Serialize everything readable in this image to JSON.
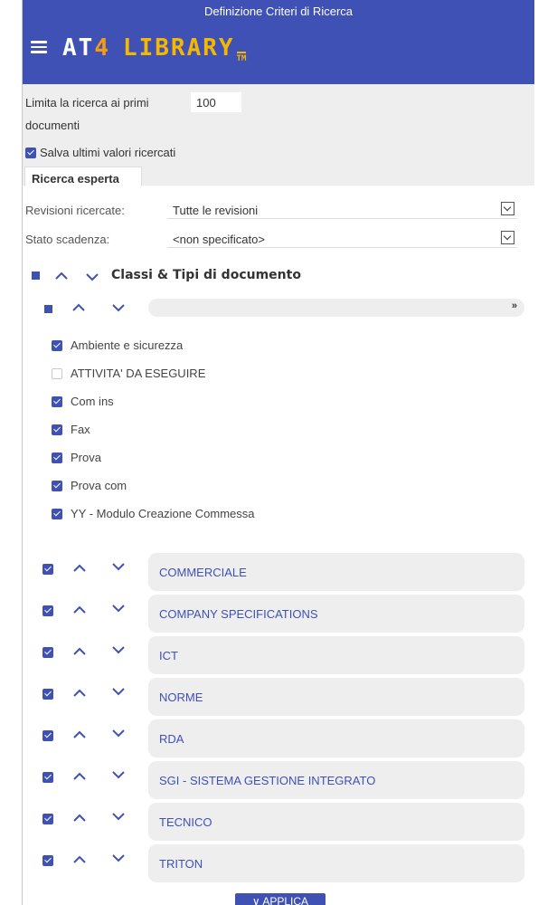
{
  "window": {
    "title": "Definizione Criteri di Ricerca"
  },
  "app": {
    "logo_at": "AT",
    "logo_four": "4",
    "logo_library": "LIBRARY",
    "logo_tm": "TM"
  },
  "options": {
    "limit_prefix": "Limita la ricerca ai primi",
    "limit_value": "100",
    "limit_suffix": "documenti",
    "save_label": "Salva ultimi valori ricercati",
    "save_checked": true
  },
  "tabs": [
    {
      "label": "Ricerca esperta",
      "active": true
    }
  ],
  "filters": {
    "revisions_label": "Revisioni ricercate:",
    "revisions_value": "Tutte le revisioni",
    "expiry_label": "Stato scadenza:",
    "expiry_value": "<non specificato>"
  },
  "section": {
    "title": "Classi & Tipi di documento"
  },
  "subgroup": {
    "value": ""
  },
  "doc_types": [
    {
      "label": "Ambiente e sicurezza",
      "checked": true
    },
    {
      "label": "ATTIVITA' DA ESEGUIRE",
      "checked": false
    },
    {
      "label": "Com ins",
      "checked": true
    },
    {
      "label": "Fax",
      "checked": true
    },
    {
      "label": "Prova",
      "checked": true
    },
    {
      "label": "Prova com",
      "checked": true
    },
    {
      "label": "YY - Modulo Creazione Commessa",
      "checked": true
    }
  ],
  "categories": [
    {
      "label": "COMMERCIALE",
      "checked": true
    },
    {
      "label": "COMPANY SPECIFICATIONS",
      "checked": true
    },
    {
      "label": "ICT",
      "checked": true
    },
    {
      "label": "NORME",
      "checked": true
    },
    {
      "label": "RDA",
      "checked": true
    },
    {
      "label": "SGI - SISTEMA GESTIONE INTEGRATO",
      "checked": true
    },
    {
      "label": "TECNICO",
      "checked": true
    },
    {
      "label": "TRITON",
      "checked": true
    }
  ],
  "actions": {
    "apply_label": "APPLICA"
  },
  "colors": {
    "header": "#3f51b5",
    "accent": "#3f51b5",
    "logo": "#f5b700",
    "panel": "#eeeeee"
  },
  "icons": [
    "menu-icon",
    "chevron-up-icon",
    "chevron-down-icon",
    "double-chevron-down-icon",
    "checkbox-icon"
  ]
}
